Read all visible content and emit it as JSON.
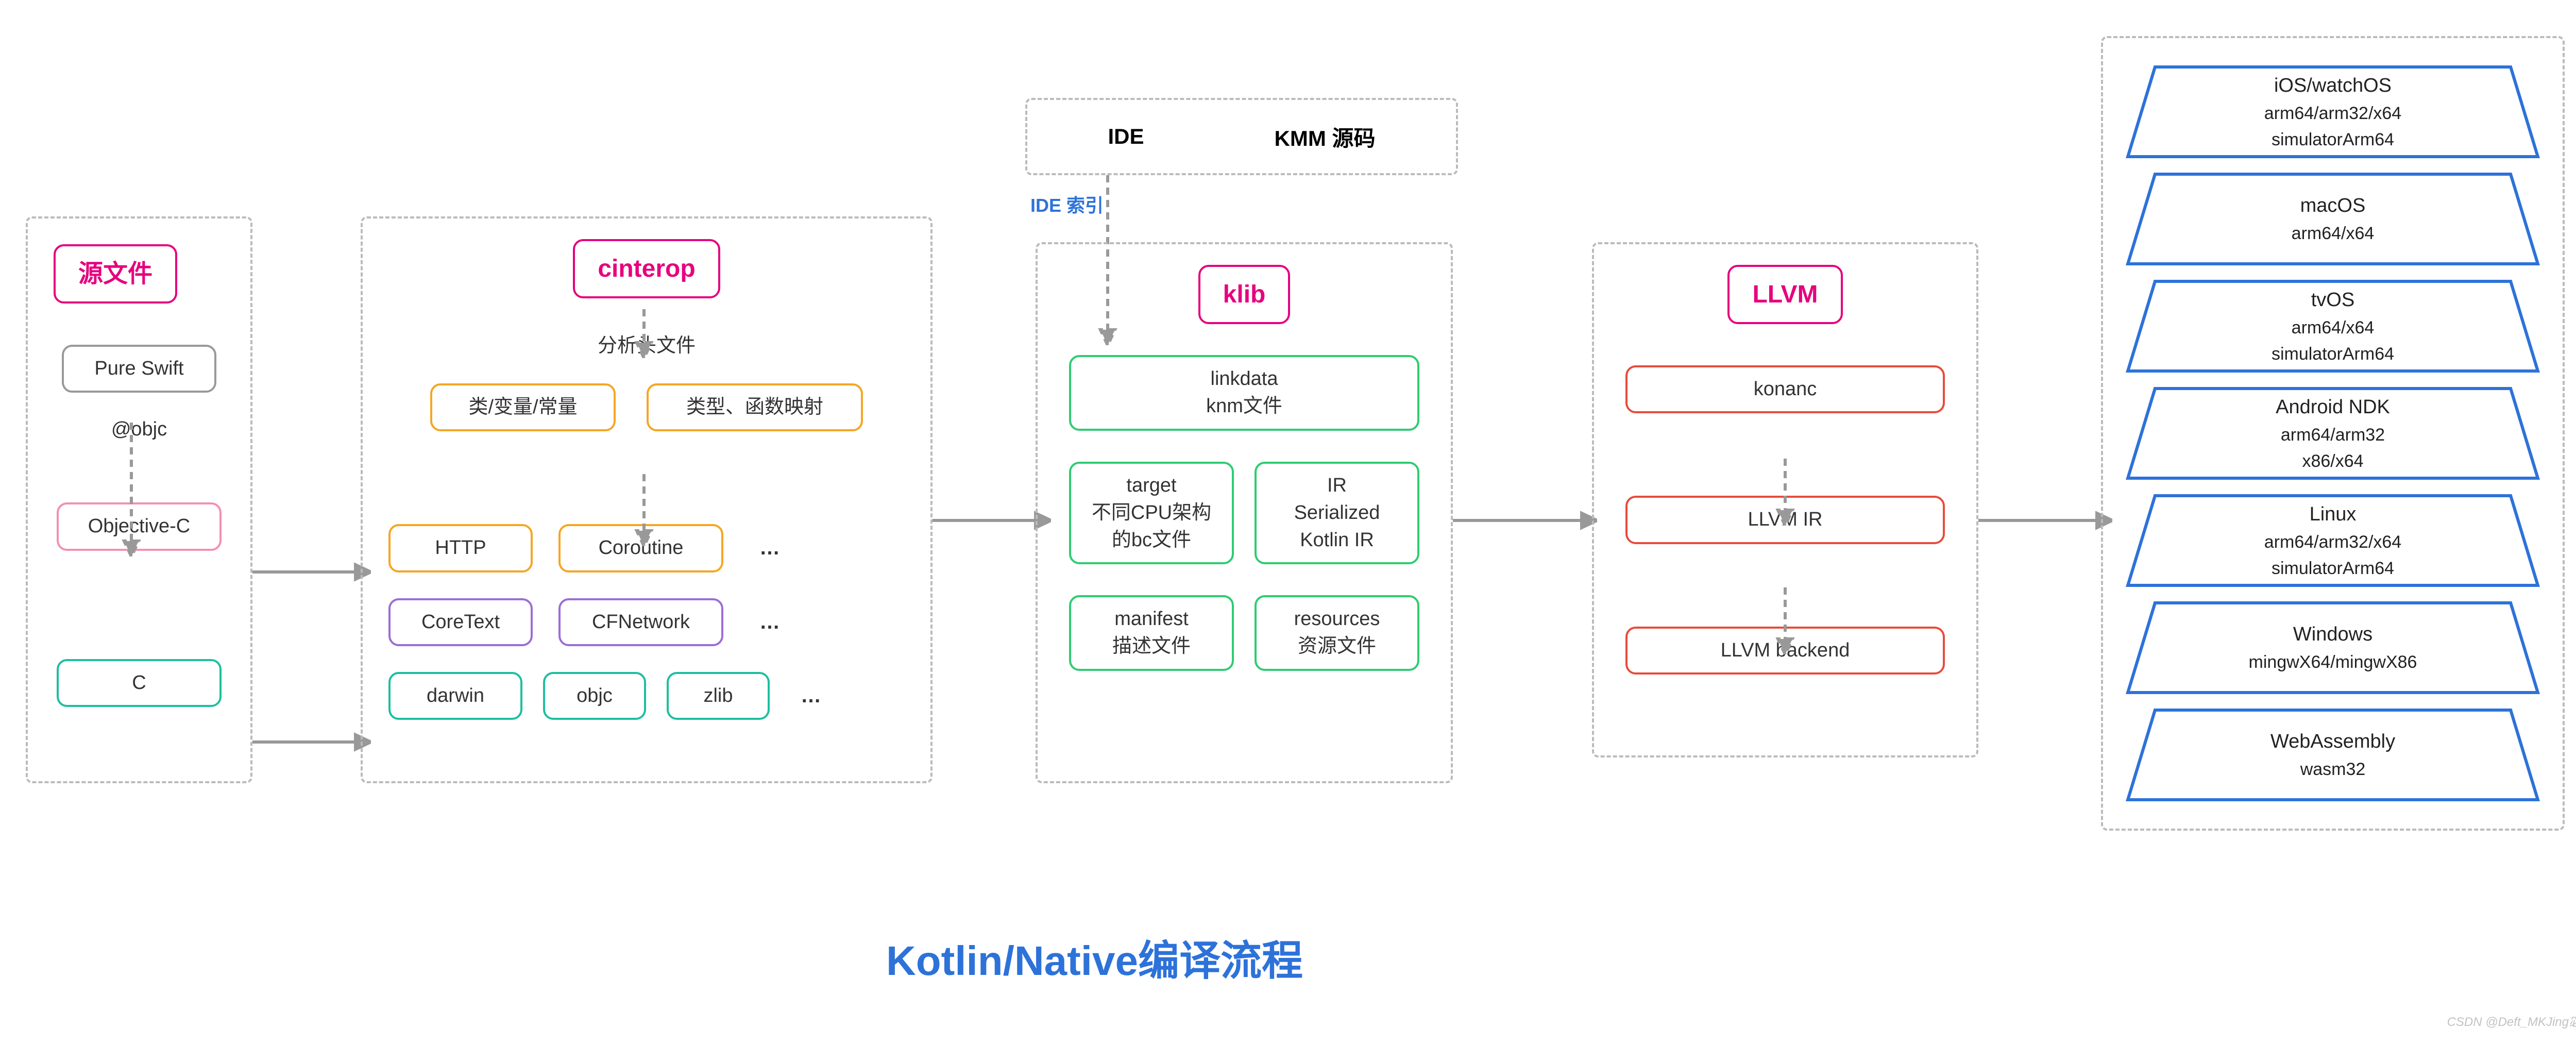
{
  "title": "Kotlin/Native编译流程",
  "source": {
    "header": "源文件",
    "pure_swift": "Pure Swift",
    "objc_lbl": "@objc",
    "objc": "Objective-C",
    "c": "C"
  },
  "cinterop": {
    "header": "cinterop",
    "analyze": "分析头文件",
    "classes": "类/变量/常量",
    "type_map": "类型、函数映射",
    "http": "HTTP",
    "coroutine": "Coroutine",
    "coretext": "CoreText",
    "cfnetwork": "CFNetwork",
    "darwin": "darwin",
    "objc": "objc",
    "zlib": "zlib",
    "dots": "…"
  },
  "ide": {
    "ide": "IDE",
    "kmm_src": "KMM 源码",
    "ide_index": "IDE 索引"
  },
  "klib": {
    "header": "klib",
    "linkdata1": "linkdata",
    "linkdata2": "knm文件",
    "target1": "target",
    "target2": "不同CPU架构",
    "target3": "的bc文件",
    "ir1": "IR",
    "ir2": "Serialized",
    "ir3": "Kotlin IR",
    "manifest1": "manifest",
    "manifest2": "描述文件",
    "res1": "resources",
    "res2": "资源文件"
  },
  "llvm": {
    "header": "LLVM",
    "konanc": "konanc",
    "ir": "LLVM IR",
    "backend": "LLVM backend"
  },
  "targets": [
    {
      "title": "iOS/watchOS",
      "sub": "arm64/arm32/x64\nsimulatorArm64"
    },
    {
      "title": "macOS",
      "sub": "arm64/x64"
    },
    {
      "title": "tvOS",
      "sub": "arm64/x64\nsimulatorArm64"
    },
    {
      "title": "Android NDK",
      "sub": "arm64/arm32\nx86/x64"
    },
    {
      "title": "Linux",
      "sub": "arm64/arm32/x64\nsimulatorArm64"
    },
    {
      "title": "Windows",
      "sub": "mingwX64/mingwX86"
    },
    {
      "title": "WebAssembly",
      "sub": "wasm32"
    }
  ],
  "watermark": "CSDN @Deft_MKJing宓珂璟"
}
